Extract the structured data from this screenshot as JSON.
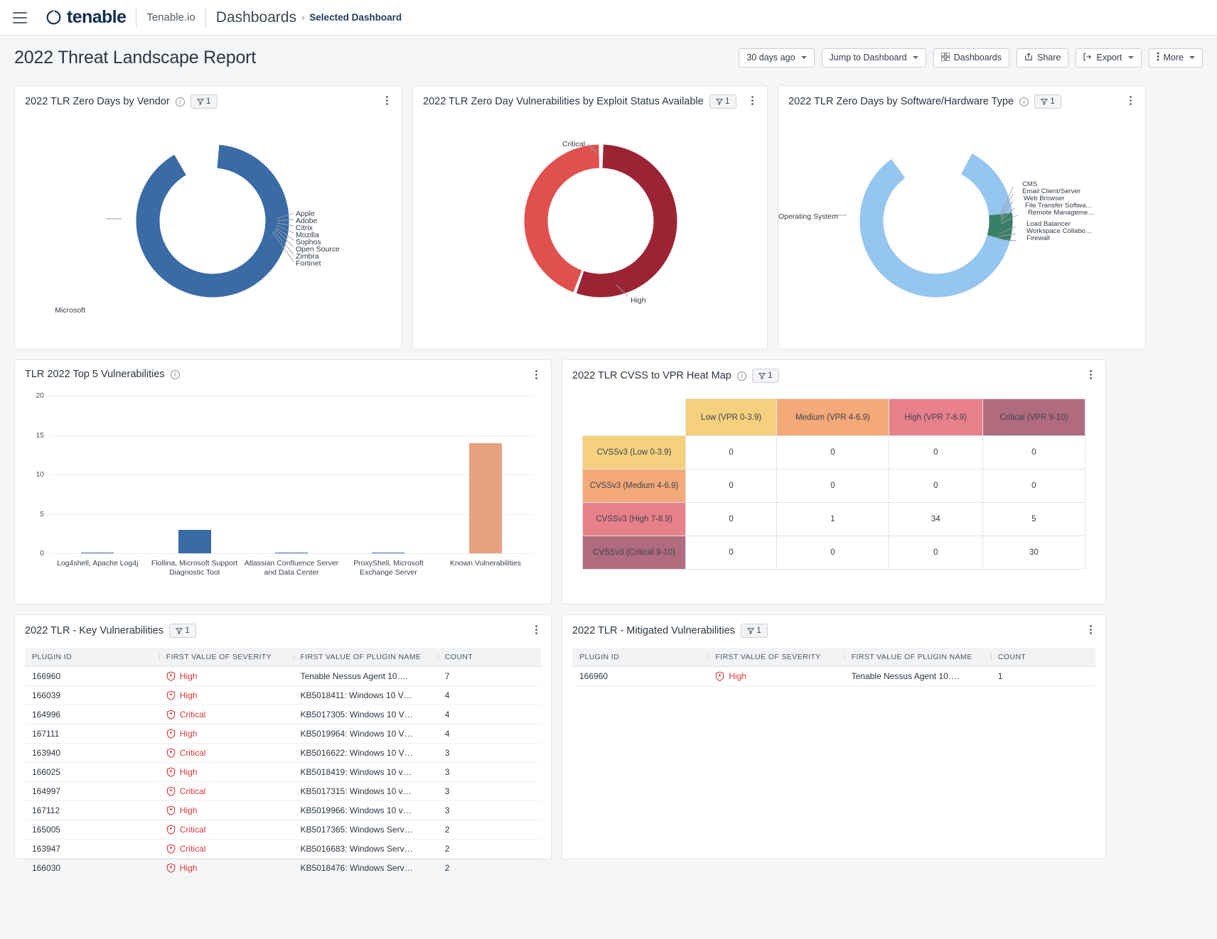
{
  "nav": {
    "menu_icon": "hamburger-icon",
    "brand": "tenable",
    "product": "Tenable.io",
    "breadcrumb_root": "Dashboards",
    "breadcrumb_sep": "›",
    "breadcrumb_current": "Selected Dashboard"
  },
  "header": {
    "title": "2022 Threat Landscape Report",
    "buttons": [
      {
        "label": "30 days ago",
        "icon": "chevron-down-icon",
        "caret": true
      },
      {
        "label": "Jump to Dashboard",
        "icon": "chevron-down-icon",
        "caret": true
      },
      {
        "label": "Dashboards",
        "icon": "grid-icon",
        "caret": false
      },
      {
        "label": "Share",
        "icon": "share-icon",
        "caret": false
      },
      {
        "label": "Export",
        "icon": "export-icon",
        "caret": true
      },
      {
        "label": "More",
        "icon": "kebab-icon",
        "caret": true
      }
    ]
  },
  "filter_chip_label": "1",
  "cards": {
    "vendor": {
      "title": "2022 TLR Zero Days by Vendor",
      "has_info": true,
      "has_filter": true
    },
    "exploit": {
      "title": "2022 TLR Zero Day Vulnerabilities by Exploit Status Available",
      "has_info": false,
      "has_filter": true
    },
    "swhw": {
      "title": "2022 TLR Zero Days by Software/Hardware Type",
      "has_info": true,
      "has_filter": true
    },
    "top5": {
      "title": "TLR 2022 Top 5 Vulnerabilities",
      "has_info": true,
      "has_filter": false
    },
    "heat": {
      "title": "2022 TLR CVSS to VPR Heat Map",
      "has_info": true,
      "has_filter": true
    },
    "key": {
      "title": "2022 TLR - Key Vulnerabilities",
      "has_info": false,
      "has_filter": true
    },
    "mitigated": {
      "title": "2022 TLR - Mitigated Vulnerabilities",
      "has_info": false,
      "has_filter": true
    }
  },
  "chart_data": [
    {
      "type": "pie",
      "title": "2022 TLR Zero Days by Vendor",
      "legend_position": "callout-labels",
      "labels": [
        "Microsoft",
        "Apple",
        "Adobe",
        "Citrix",
        "Mozilla",
        "Sophos",
        "Open Source",
        "Zimbra",
        "Fortinet"
      ],
      "values": [
        36,
        1,
        1,
        1,
        1,
        1,
        1,
        1,
        1
      ],
      "colors": [
        "#3a6ba5",
        "#3a6ba5",
        "#3a6ba5",
        "#3a6ba5",
        "#3a6ba5",
        "#3a6ba5",
        "#3a6ba5",
        "#3a6ba5",
        "#3a6ba5"
      ]
    },
    {
      "type": "pie",
      "title": "2022 TLR Zero Day Vulnerabilities by Exploit Status Available",
      "legend_position": "callout-labels",
      "labels": [
        "Critical",
        "High"
      ],
      "values": [
        55,
        45
      ],
      "colors": [
        "#9c2333",
        "#e15martin"
      ]
    },
    {
      "type": "pie",
      "title": "2022 TLR Zero Days by Software/Hardware Type",
      "legend_position": "callout-labels",
      "labels": [
        "Operating System",
        "CMS",
        "Email Client/Server",
        "Web Browser",
        "File Transfer Softwa…",
        "Remote Manageme…",
        "Load Balancer",
        "Workspace Collabo…",
        "Firewall"
      ],
      "values": [
        78,
        2,
        2,
        2,
        2,
        6,
        2,
        2,
        2
      ],
      "colors": [
        "#95c6ef",
        "#3a8066"
      ]
    },
    {
      "type": "bar",
      "title": "TLR 2022 Top 5 Vulnerabilities",
      "categories": [
        "Log4shell, Apache Log4j",
        "Flollina, Microsoft Support Diagnostic Tool",
        "Atlassian Confluence Server and Data Center",
        "ProxyShell, Microsoft Exchange Server",
        "Known Vulnerabilities"
      ],
      "values": [
        0,
        3,
        0,
        0,
        14
      ],
      "bar_colors": [
        "#3a6ba5",
        "#3a6ba5",
        "#3a6ba5",
        "#3a6ba5",
        "#e8a27f"
      ],
      "xlabel": "",
      "ylabel": "",
      "ylim": [
        0,
        20
      ],
      "yticks": [
        0,
        5,
        10,
        15,
        20
      ],
      "grid": true
    },
    {
      "type": "heatmap",
      "title": "2022 TLR CVSS to VPR Heat Map",
      "columns": [
        "Low (VPR 0-3.9)",
        "Medium (VPR 4-6.9)",
        "High (VPR 7-8.9)",
        "Critical (VPR 9-10)"
      ],
      "rows": [
        "CVSSv3 (Low 0-3.9)",
        "CVSSv3 (Medium 4-6.9)",
        "CVSSv3 (High 7-8.9)",
        "CVSSv3 (Critical 9-10)"
      ],
      "values": [
        [
          0,
          0,
          0,
          0
        ],
        [
          0,
          0,
          0,
          0
        ],
        [
          0,
          1,
          34,
          5
        ],
        [
          0,
          0,
          0,
          30
        ]
      ],
      "col_colors": [
        "#f5d17e",
        "#f3a978",
        "#e8808a",
        "#b06b7e"
      ],
      "row_colors": [
        "#f5d17e",
        "#f3a978",
        "#e8808a",
        "#b06b7e"
      ]
    }
  ],
  "key_table": {
    "columns": [
      "PLUGIN ID",
      "FIRST VALUE OF SEVERITY",
      "FIRST VALUE OF PLUGIN NAME",
      "COUNT"
    ],
    "rows": [
      {
        "plugin_id": "166960",
        "severity": "High",
        "plugin_name": "Tenable Nessus Agent 10….",
        "count": "7"
      },
      {
        "plugin_id": "166039",
        "severity": "High",
        "plugin_name": "KB5018411: Windows 10 V…",
        "count": "4"
      },
      {
        "plugin_id": "164996",
        "severity": "Critical",
        "plugin_name": "KB5017305: Windows 10 V…",
        "count": "4"
      },
      {
        "plugin_id": "167111",
        "severity": "High",
        "plugin_name": "KB5019964: Windows 10 V…",
        "count": "4"
      },
      {
        "plugin_id": "163940",
        "severity": "Critical",
        "plugin_name": "KB5016622: Windows 10 V…",
        "count": "3"
      },
      {
        "plugin_id": "166025",
        "severity": "High",
        "plugin_name": "KB5018419: Windows 10 v…",
        "count": "3"
      },
      {
        "plugin_id": "164997",
        "severity": "Critical",
        "plugin_name": "KB5017315: Windows 10 v…",
        "count": "3"
      },
      {
        "plugin_id": "167112",
        "severity": "High",
        "plugin_name": "KB5019966: Windows 10 v…",
        "count": "3"
      },
      {
        "plugin_id": "165005",
        "severity": "Critical",
        "plugin_name": "KB5017365: Windows Serv…",
        "count": "2"
      },
      {
        "plugin_id": "163947",
        "severity": "Critical",
        "plugin_name": "KB5016683: Windows Serv…",
        "count": "2"
      },
      {
        "plugin_id": "166030",
        "severity": "High",
        "plugin_name": "KB5018476: Windows Serv…",
        "count": "2"
      }
    ]
  },
  "mitigated_table": {
    "columns": [
      "PLUGIN ID",
      "FIRST VALUE OF SEVERITY",
      "FIRST VALUE OF PLUGIN NAME",
      "COUNT"
    ],
    "rows": [
      {
        "plugin_id": "166960",
        "severity": "High",
        "plugin_name": "Tenable Nessus Agent 10….",
        "count": "1"
      }
    ]
  },
  "colors": {
    "brand_navy": "#11304f",
    "blue": "#3a6ba5",
    "light_blue": "#95c6ef",
    "green": "#3a8066",
    "peach": "#e8a27f",
    "crimson": "#9c2333",
    "red": "#e0514e",
    "severity_red": "#d8393b"
  }
}
